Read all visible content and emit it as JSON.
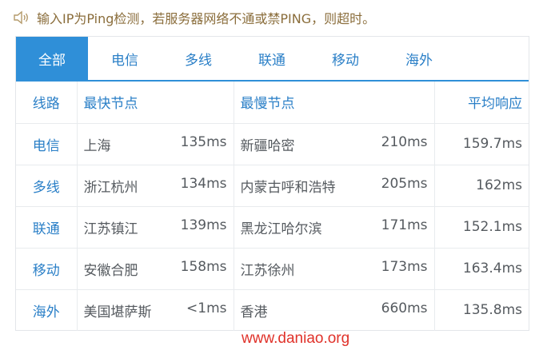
{
  "notice": {
    "icon": "speaker-icon",
    "text": "输入IP为Ping检测，若服务器网络不通或禁PING，则超时。"
  },
  "tabs": [
    {
      "label": "全部",
      "active": true
    },
    {
      "label": "电信",
      "active": false
    },
    {
      "label": "多线",
      "active": false
    },
    {
      "label": "联通",
      "active": false
    },
    {
      "label": "移动",
      "active": false
    },
    {
      "label": "海外",
      "active": false
    }
  ],
  "table": {
    "headers": {
      "line": "线路",
      "fastest": "最快节点",
      "slowest": "最慢节点",
      "average": "平均响应"
    },
    "rows": [
      {
        "line": "电信",
        "fast_node": "上海",
        "fast_ms": "135ms",
        "slow_node": "新疆哈密",
        "slow_ms": "210ms",
        "avg": "159.7ms"
      },
      {
        "line": "多线",
        "fast_node": "浙江杭州",
        "fast_ms": "134ms",
        "slow_node": "内蒙古呼和浩特",
        "slow_ms": "205ms",
        "avg": "162ms"
      },
      {
        "line": "联通",
        "fast_node": "江苏镇江",
        "fast_ms": "139ms",
        "slow_node": "黑龙江哈尔滨",
        "slow_ms": "171ms",
        "avg": "152.1ms"
      },
      {
        "line": "移动",
        "fast_node": "安徽合肥",
        "fast_ms": "158ms",
        "slow_node": "江苏徐州",
        "slow_ms": "173ms",
        "avg": "163.4ms"
      },
      {
        "line": "海外",
        "fast_node": "美国堪萨斯",
        "fast_ms": "<1ms",
        "slow_node": "香港",
        "slow_ms": "660ms",
        "avg": "135.8ms"
      }
    ]
  },
  "watermark": "www.daniao.org",
  "colors": {
    "accent": "#2f8fd8",
    "notice": "#8a6d3b",
    "watermark": "#e0322a"
  }
}
